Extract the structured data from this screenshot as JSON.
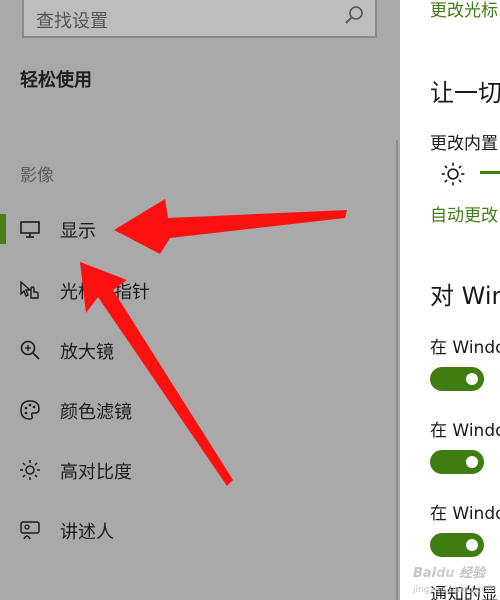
{
  "search": {
    "placeholder": "查找设置",
    "icon": "search-icon"
  },
  "sidebar": {
    "section_title": "轻松使用",
    "group_label": "影像",
    "items": [
      {
        "label": "显示",
        "icon": "monitor-icon",
        "selected": true
      },
      {
        "label": "光标和指针",
        "icon": "pointer-hand-icon",
        "selected": false
      },
      {
        "label": "放大镜",
        "icon": "magnifier-icon",
        "selected": false
      },
      {
        "label": "颜色滤镜",
        "icon": "palette-icon",
        "selected": false
      },
      {
        "label": "高对比度",
        "icon": "brightness-icon",
        "selected": false
      },
      {
        "label": "讲述人",
        "icon": "narrator-icon",
        "selected": false
      }
    ]
  },
  "content": {
    "top_link": "更改光标",
    "heading1": "让一切",
    "subheading": "更改内置",
    "brightness_icon": "sun-icon",
    "auto_link": "自动更改",
    "heading2": "对 Win",
    "toggles": [
      {
        "label": "在 Windo",
        "state": "on"
      },
      {
        "label": "在 Windo",
        "state": "on"
      },
      {
        "label": "在 Windo",
        "state": "on"
      }
    ],
    "bottom_text": "通知的显"
  },
  "watermark": "Baidu 经验\njingyan.baidu.com",
  "colors": {
    "accent": "#3f7d11",
    "selection_bar": "#4e7d17",
    "sidebar_bg": "#a9a9a9",
    "arrow": "#ff0000"
  }
}
